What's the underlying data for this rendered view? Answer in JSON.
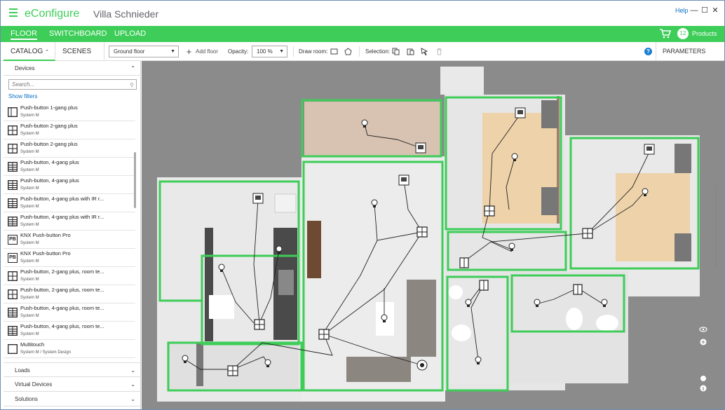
{
  "window": {
    "help": "Help",
    "min": "—",
    "max": "☐",
    "close": "✕"
  },
  "brand": "eConfigure",
  "project": "Villa Schnieder",
  "nav": {
    "floor": "FLOOR",
    "switchboard": "SWITCHBOARD",
    "upload": "UPLOAD",
    "cart_count": "12",
    "products": "Products"
  },
  "toolbar": {
    "catalog": "CATALOG",
    "scenes": "SCENES",
    "floor_select": "Ground floor",
    "add_floor": "Add floor",
    "opacity_label": "Opacity:",
    "opacity_value": "100 %",
    "draw_room": "Draw room:",
    "selection": "Selection:",
    "parameters": "PARAMETERS",
    "help_glyph": "?"
  },
  "sidebar": {
    "devices": "Devices",
    "search_placeholder": "Search...",
    "show_filters": "Show filters",
    "items": [
      {
        "name": "Push-button 1-gang plus",
        "sub": "System M",
        "icon": "1"
      },
      {
        "name": "Push-button 2-gang plus",
        "sub": "System M",
        "icon": "4"
      },
      {
        "name": "Push-button 2-gang plus",
        "sub": "System M",
        "icon": "4"
      },
      {
        "name": "Push-button, 4-gang plus",
        "sub": "System M",
        "icon": "8"
      },
      {
        "name": "Push-button, 4-gang plus",
        "sub": "System M",
        "icon": "8"
      },
      {
        "name": "Push-button, 4-gang plus with IR r...",
        "sub": "System M",
        "icon": "8"
      },
      {
        "name": "Push-button, 4-gang plus with IR r...",
        "sub": "System M",
        "icon": "8"
      },
      {
        "name": "KNX Push-button Pro",
        "sub": "System M",
        "icon": "PB"
      },
      {
        "name": "KNX Push-button Pro",
        "sub": "System M",
        "icon": "PB"
      },
      {
        "name": "Push-button, 2-gang plus, room te...",
        "sub": "System M",
        "icon": "4r"
      },
      {
        "name": "Push-button, 2-gang plus, room te...",
        "sub": "System M",
        "icon": "4r"
      },
      {
        "name": "Push-button, 4-gang plus, room te...",
        "sub": "System M",
        "icon": "8r"
      },
      {
        "name": "Push-button, 4-gang plus, room te...",
        "sub": "System M",
        "icon": "8r"
      },
      {
        "name": "Multitouch",
        "sub": "System M / System Design",
        "icon": "0"
      }
    ],
    "loads": "Loads",
    "virtual_devices": "Virtual Devices",
    "solutions": "Solutions"
  },
  "colors": {
    "accent": "#3dcd58",
    "link": "#0a70c4"
  }
}
